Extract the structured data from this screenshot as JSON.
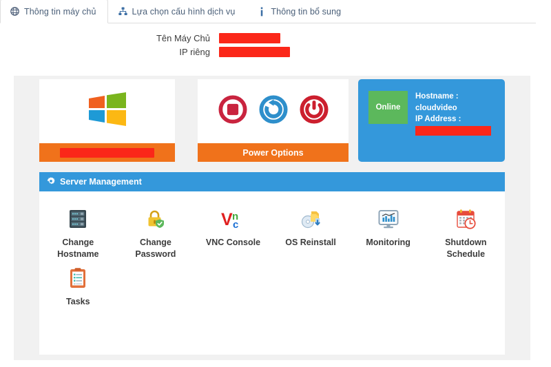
{
  "tabs": [
    {
      "label": "Thông tin máy chủ",
      "icon": "globe-icon",
      "active": true
    },
    {
      "label": "Lựa chọn cấu hình dịch vụ",
      "icon": "sitemap-icon",
      "active": false
    },
    {
      "label": "Thông tin bổ sung",
      "icon": "info-icon",
      "active": false
    }
  ],
  "fields": [
    {
      "label": "Tên Máy Chủ",
      "value": "",
      "redacted": true,
      "redact_width": 89
    },
    {
      "label": "IP riêng",
      "value": "",
      "redacted": true,
      "redact_width": 103
    }
  ],
  "cards": {
    "os": {
      "icon": "windows-logo-icon",
      "footer_label": "",
      "footer_redacted": true,
      "footer_redact_width": 137
    },
    "power": {
      "footer_label": "Power Options",
      "actions": [
        {
          "name": "stop-icon",
          "color": "#c9243f"
        },
        {
          "name": "reboot-icon",
          "color": "#2e8fcb"
        },
        {
          "name": "power-icon",
          "color": "#cc1f2e"
        }
      ]
    }
  },
  "info_panel": {
    "status_badge": "Online",
    "hostname_label": "Hostname :",
    "hostname_value": "cloudvideo",
    "ip_label": "IP Address :",
    "ip_value": "",
    "ip_redacted": true
  },
  "server_management": {
    "header": "Server Management",
    "header_icon": "gear-icon",
    "items": [
      {
        "label": "Change Hostname",
        "icon": "server-rack-icon"
      },
      {
        "label": "Change Password",
        "icon": "lock-shield-icon"
      },
      {
        "label": "VNC Console",
        "icon": "vnc-logo-icon"
      },
      {
        "label": "OS Reinstall",
        "icon": "disc-install-icon"
      },
      {
        "label": "Monitoring",
        "icon": "monitor-chart-icon"
      },
      {
        "label": "Shutdown Schedule",
        "icon": "calendar-clock-icon"
      },
      {
        "label": "Tasks",
        "icon": "clipboard-icon"
      }
    ]
  },
  "colors": {
    "accent_blue": "#3498db",
    "accent_orange": "#f0721b",
    "status_green": "#5cb85c",
    "redaction_red": "#fb2719",
    "panel_gray": "#f1f1f1",
    "tab_text": "#4b6079"
  }
}
